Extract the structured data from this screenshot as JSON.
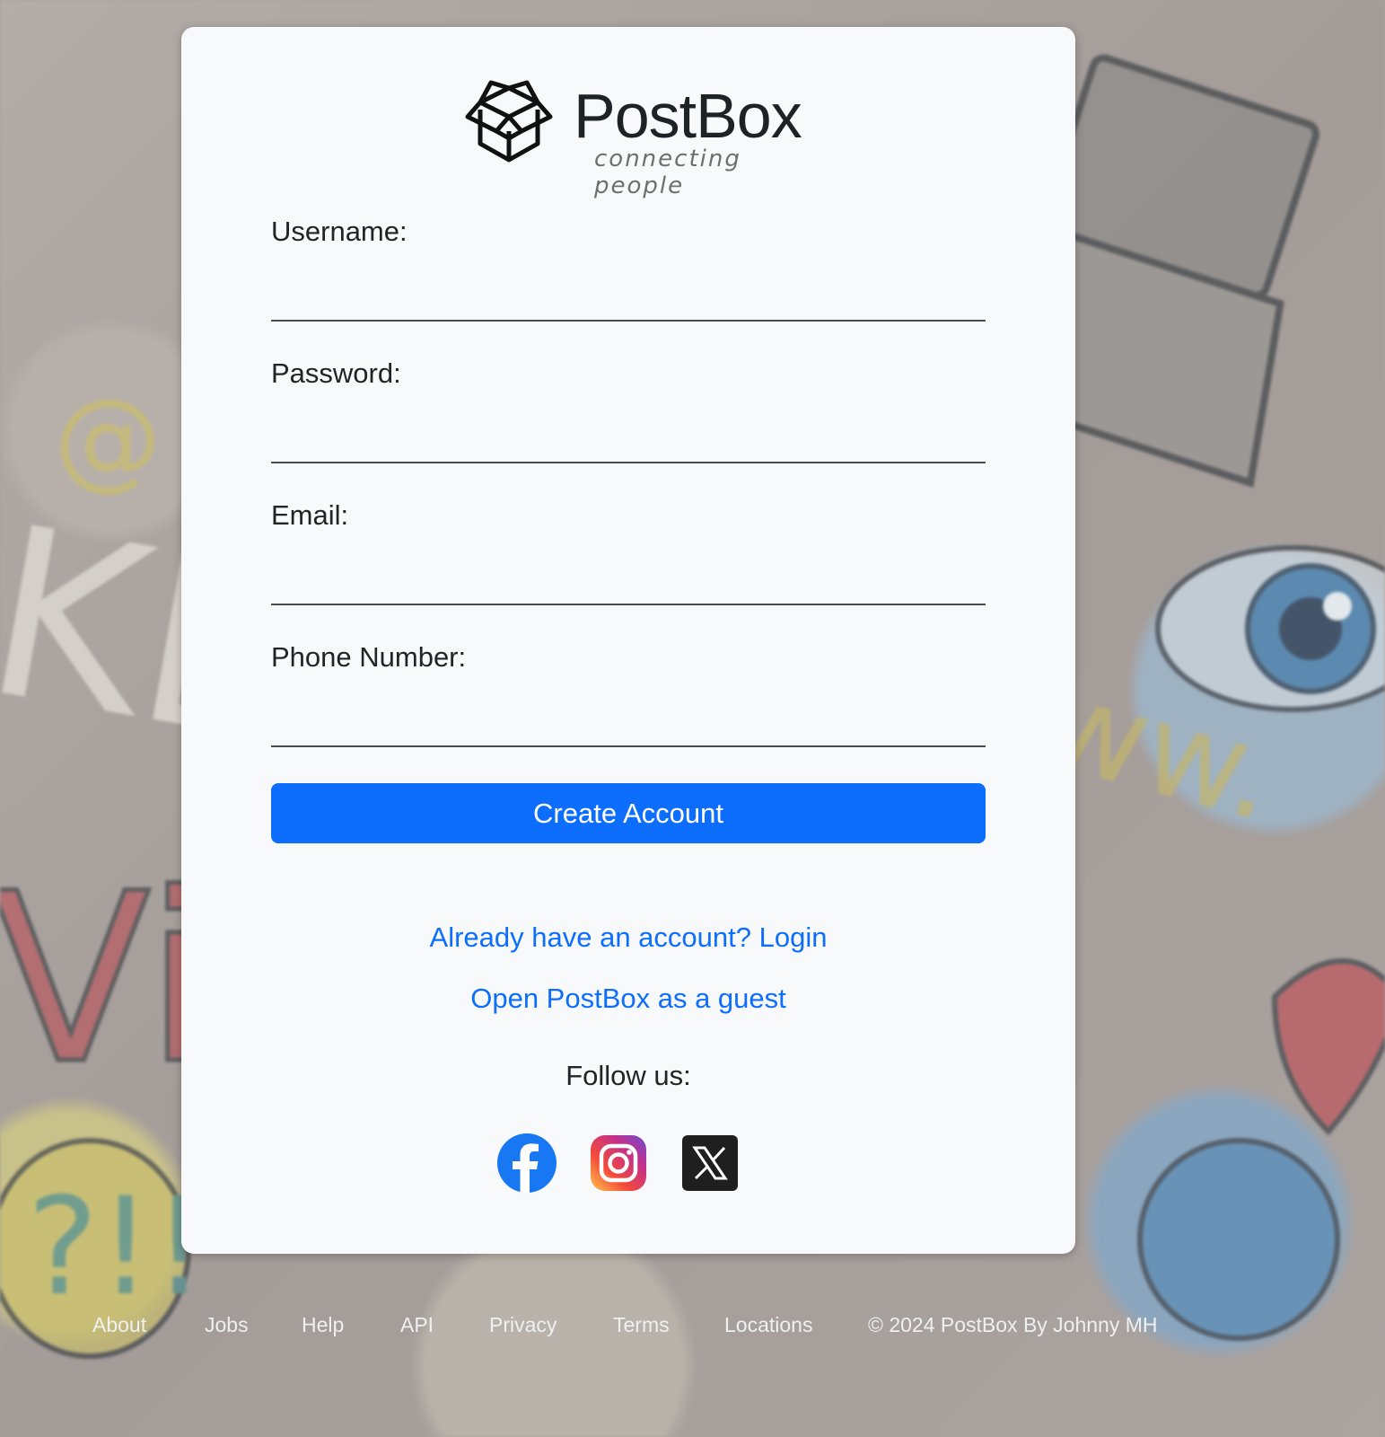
{
  "brand": {
    "name": "PostBox",
    "tagline": "connecting people"
  },
  "form": {
    "username_label": "Username:",
    "username_value": "",
    "password_label": "Password:",
    "password_value": "",
    "email_label": "Email:",
    "email_value": "",
    "phone_label": "Phone Number:",
    "phone_value": "",
    "submit_label": "Create Account"
  },
  "links": {
    "login": "Already have an account? Login",
    "guest": "Open PostBox as a guest"
  },
  "social": {
    "heading": "Follow us:",
    "icons": [
      "facebook-icon",
      "instagram-icon",
      "x-icon"
    ]
  },
  "footer": {
    "items": [
      "About",
      "Jobs",
      "Help",
      "API",
      "Privacy",
      "Terms",
      "Locations"
    ],
    "copyright": "© 2024 PostBox By Johnny MH"
  },
  "colors": {
    "accent": "#0d6efd",
    "card": "#f8f9fa",
    "text": "#212529"
  }
}
